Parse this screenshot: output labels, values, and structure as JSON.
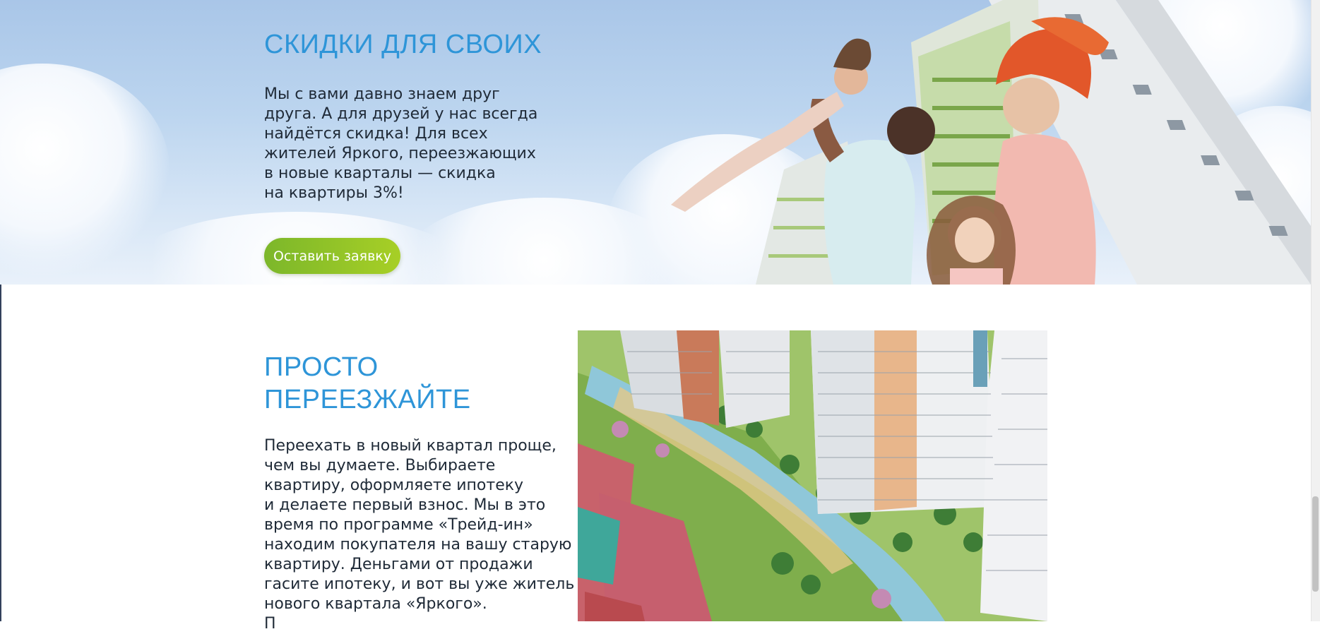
{
  "hero": {
    "title": "СКИДКИ ДЛЯ СВОИХ",
    "text_lines": [
      "Мы с вами давно знаем друг",
      "друга. А для друзей у нас всегда",
      "найдётся скидка! Для всех",
      "жителей Яркого, переезжающих",
      "в новые кварталы — скидка",
      "на квартиры 3%!"
    ],
    "button_label": "Оставить заявку"
  },
  "section2": {
    "title_lines": [
      "ПРОСТО",
      "ПЕРЕЕЗЖАЙТЕ"
    ],
    "text_lines": [
      "Переехать в новый квартал проще,",
      "чем вы думаете. Выбираете",
      "квартиру, оформляете ипотеку",
      "и делаете первый взнос. Мы в это",
      "время по программе «Трейд-ин»",
      "находим покупателя на вашу старую",
      "квартиру. Деньгами от продажи",
      "гасите ипотеку, и вот вы уже житель",
      "нового квартала «Яркого».",
      "П"
    ]
  },
  "colors": {
    "heading_blue": "#2e95d8",
    "button_green_start": "#7cb72a",
    "button_green_end": "#a7cf26",
    "body_text": "#1f2a37"
  }
}
